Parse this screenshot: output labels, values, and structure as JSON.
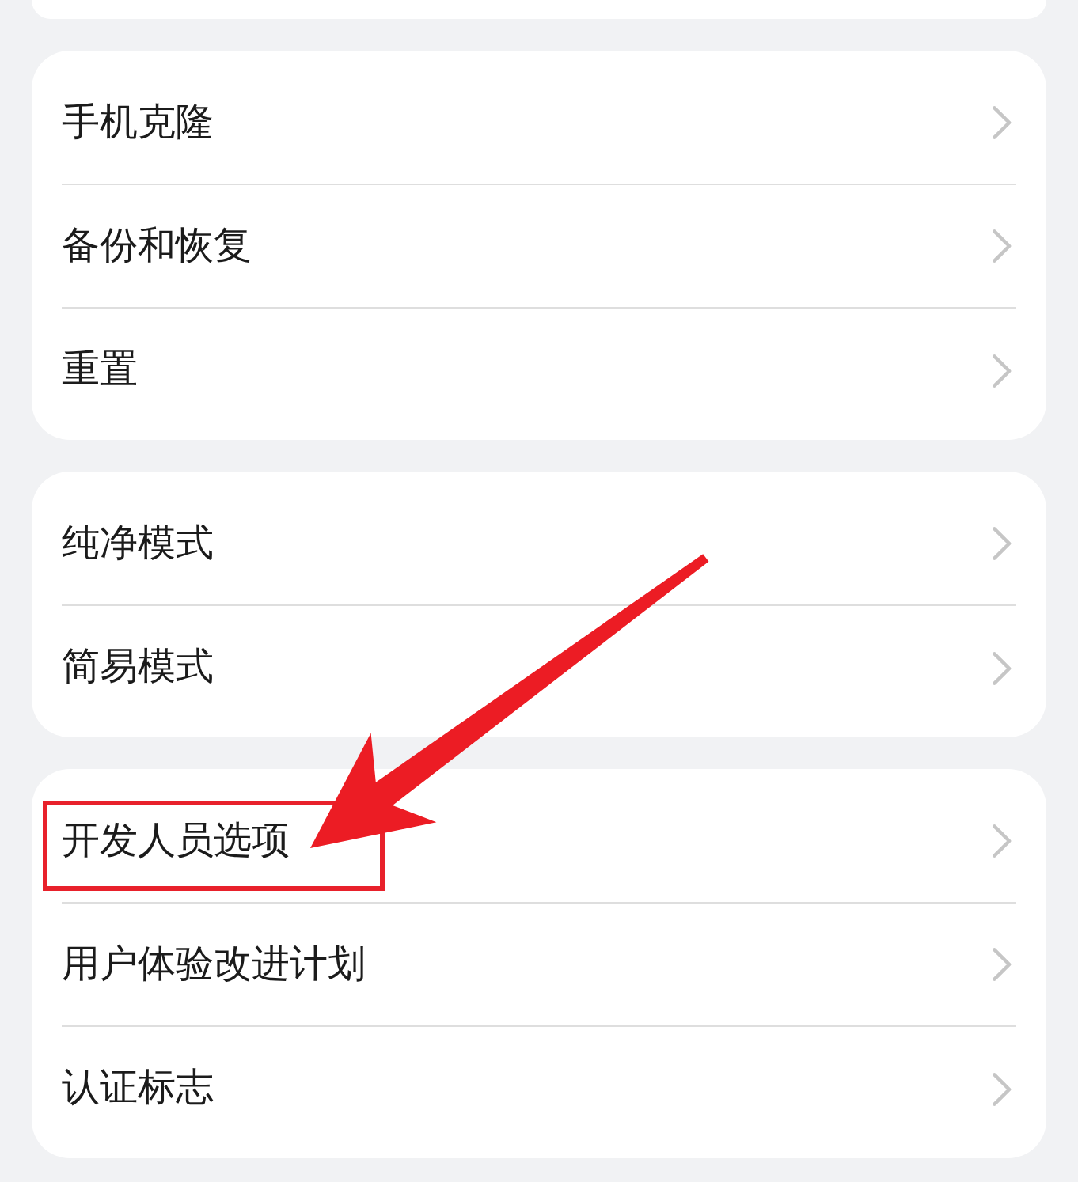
{
  "groups": [
    {
      "items": [
        {
          "label": "手机克隆",
          "highlighted": false,
          "arrow": false
        },
        {
          "label": "备份和恢复",
          "highlighted": false,
          "arrow": false
        },
        {
          "label": "重置",
          "highlighted": false,
          "arrow": false
        }
      ]
    },
    {
      "items": [
        {
          "label": "纯净模式",
          "highlighted": false,
          "arrow": false
        },
        {
          "label": "简易模式",
          "highlighted": false,
          "arrow": false
        }
      ]
    },
    {
      "items": [
        {
          "label": "开发人员选项",
          "highlighted": true,
          "arrow": true
        },
        {
          "label": "用户体验改进计划",
          "highlighted": false,
          "arrow": false
        },
        {
          "label": "认证标志",
          "highlighted": false,
          "arrow": false
        }
      ]
    }
  ]
}
